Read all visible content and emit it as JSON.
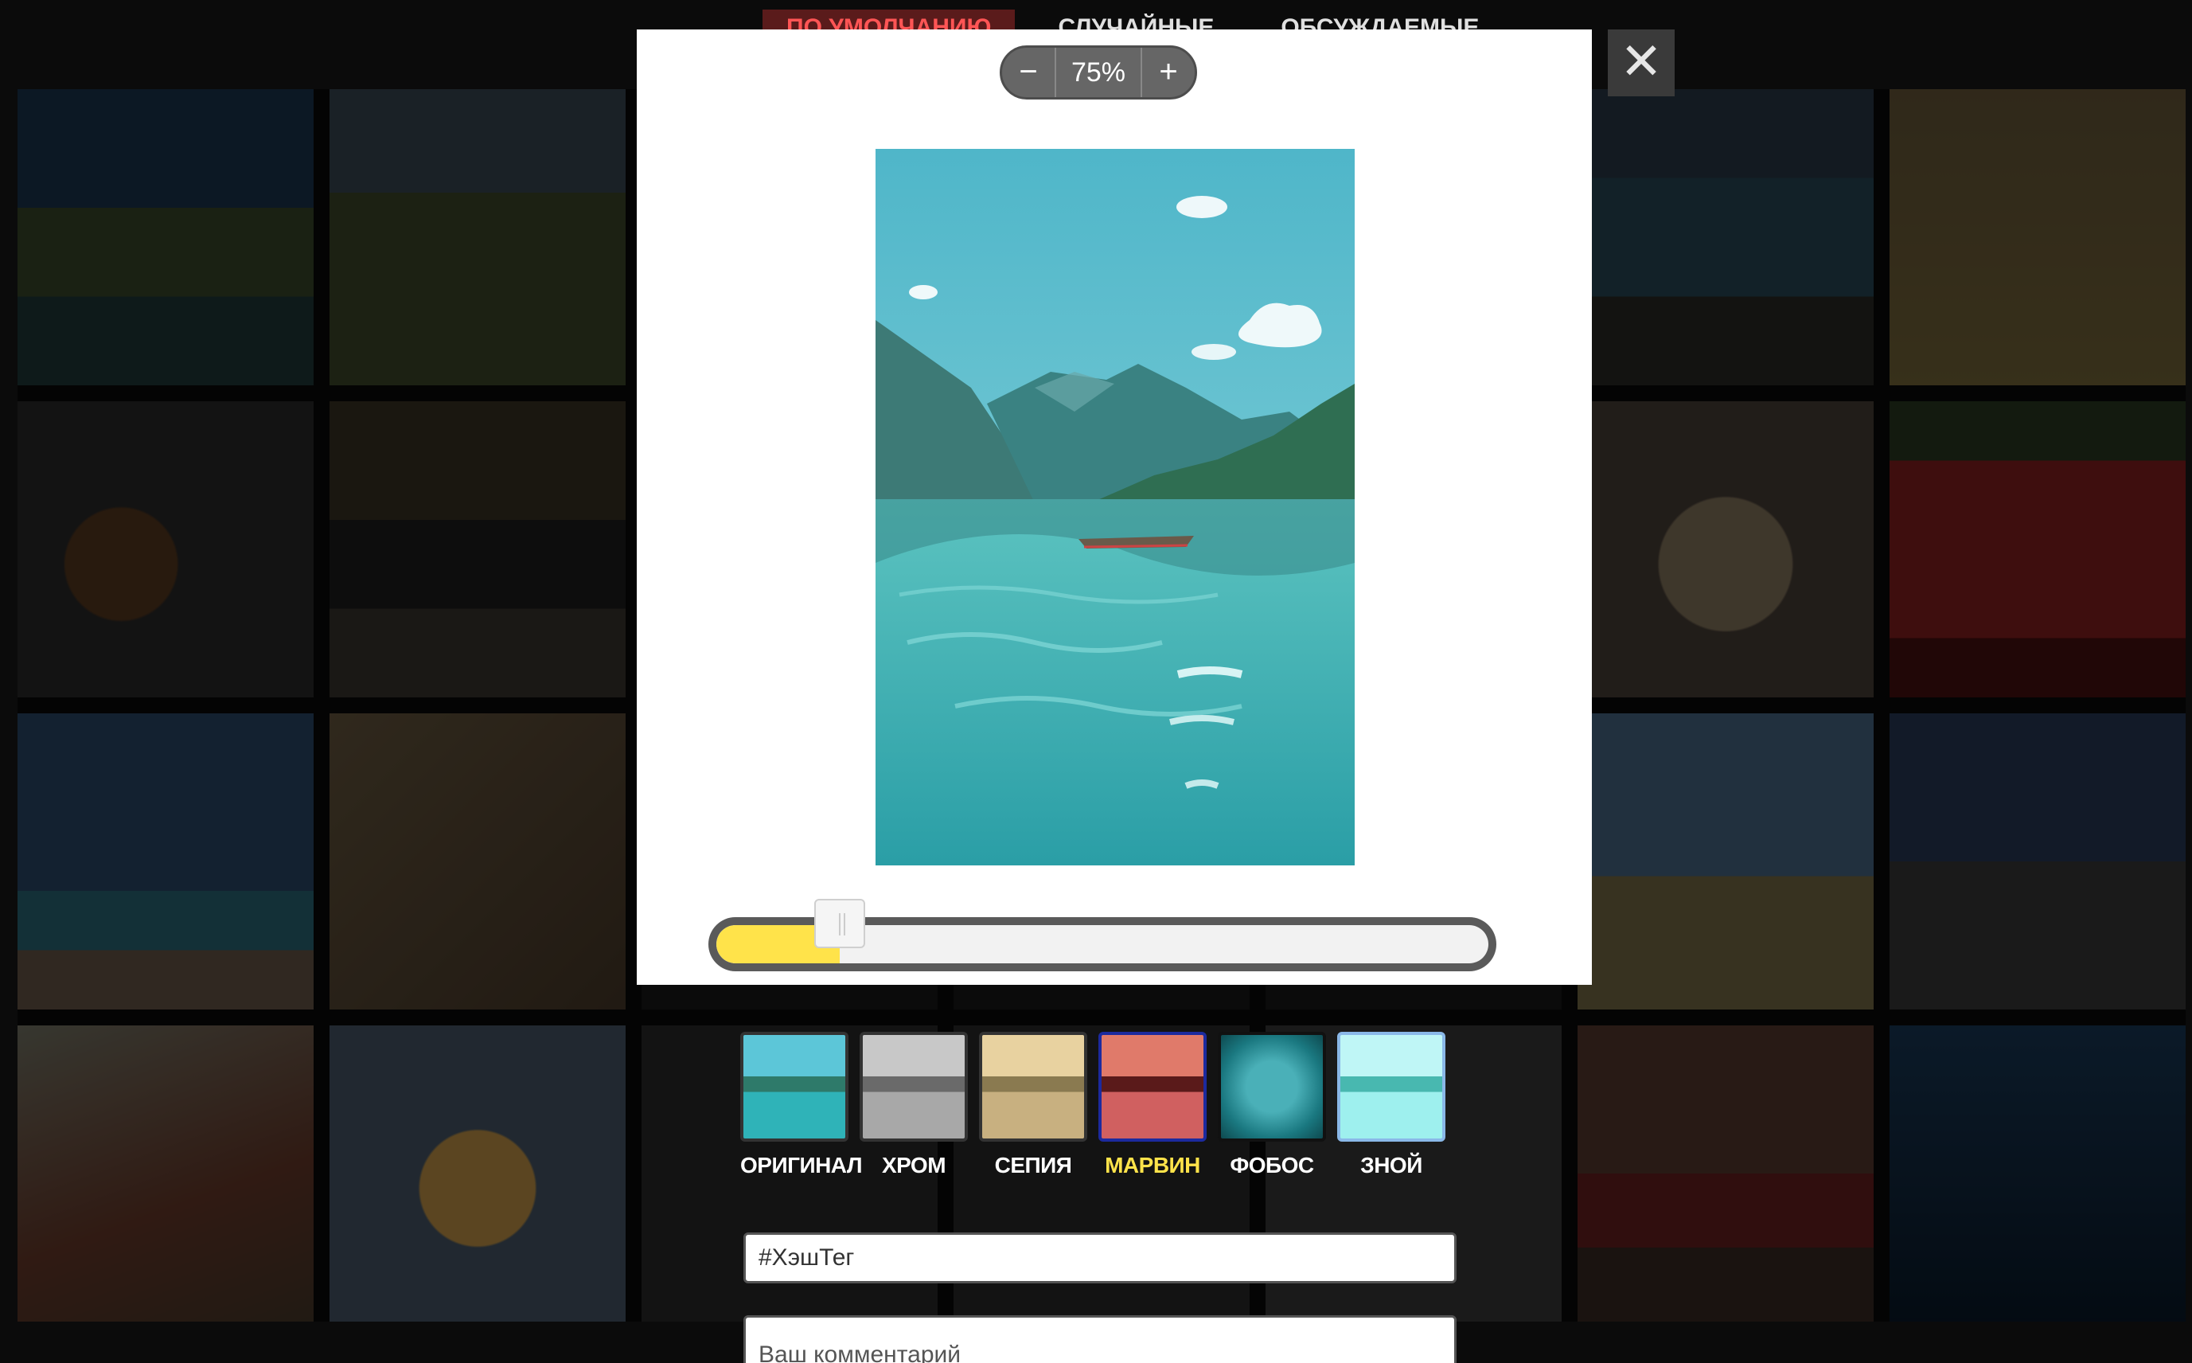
{
  "tabs": [
    "ПО УМОЛЧАНИЮ",
    "СЛУЧАЙНЫЕ",
    "ОБСУЖДАЕМЫЕ"
  ],
  "zoom": {
    "minus": "−",
    "value": "75%",
    "plus": "+"
  },
  "close_icon": "close-icon",
  "slider": {
    "level": 0.16,
    "fill_color": "#ffe34a"
  },
  "filters": [
    {
      "label": "ОРИГИНАЛ",
      "selected": false
    },
    {
      "label": "ХРОМ",
      "selected": false
    },
    {
      "label": "СЕПИЯ",
      "selected": false
    },
    {
      "label": "МАРВИН",
      "selected": true
    },
    {
      "label": "ФОБОС",
      "selected": false
    },
    {
      "label": "ЗНОЙ",
      "selected": false
    }
  ],
  "hashtag": {
    "value": "#ХэшТег"
  },
  "comment": {
    "placeholder": "Ваш комментарий"
  },
  "colors": {
    "accent_yellow": "#ffe34a",
    "selected_border": "#1c2a9e"
  }
}
